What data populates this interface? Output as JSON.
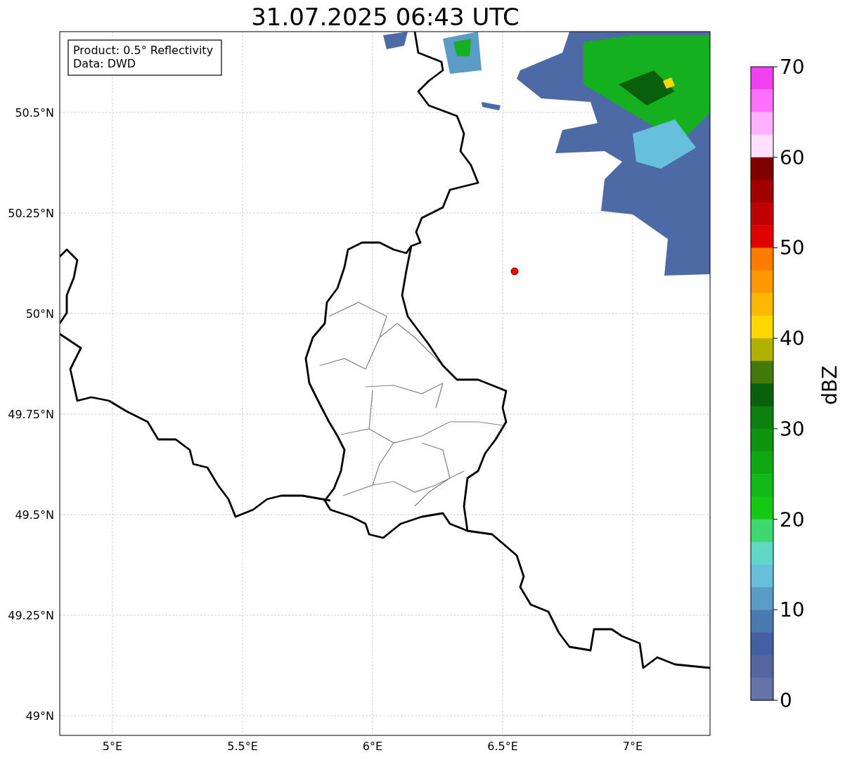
{
  "title": "31.07.2025 06:43 UTC",
  "info_box": {
    "lines": [
      "Product: 0.5° Reflectivity",
      "Data: DWD"
    ]
  },
  "y_axis": {
    "tick_labels": [
      "50.5°N",
      "50.25°N",
      "50°N",
      "49.75°N",
      "49.5°N",
      "49.25°N",
      "49°N"
    ]
  },
  "x_axis": {
    "tick_labels": [
      "5°E",
      "5.5°E",
      "6°E",
      "6.5°E",
      "7°E"
    ]
  },
  "colorbar": {
    "label": "dBZ",
    "tick_labels": [
      "70",
      "60",
      "50",
      "40",
      "30",
      "20",
      "10",
      "0"
    ],
    "bins": [
      {
        "color": "#f040f0"
      },
      {
        "color": "#ff70ff"
      },
      {
        "color": "#ffb0ff"
      },
      {
        "color": "#ffe0ff"
      },
      {
        "color": "#800000"
      },
      {
        "color": "#a00000"
      },
      {
        "color": "#c00000"
      },
      {
        "color": "#e00000"
      },
      {
        "color": "#ff7c00"
      },
      {
        "color": "#ff9800"
      },
      {
        "color": "#ffb800"
      },
      {
        "color": "#ffd700"
      },
      {
        "color": "#b0b000"
      },
      {
        "color": "#447a0a"
      },
      {
        "color": "#0a600a"
      },
      {
        "color": "#0c8010"
      },
      {
        "color": "#0e9410"
      },
      {
        "color": "#10a810"
      },
      {
        "color": "#10b818"
      },
      {
        "color": "#14c814"
      },
      {
        "color": "#3ed870"
      },
      {
        "color": "#60d8c8"
      },
      {
        "color": "#66c0dc"
      },
      {
        "color": "#5a9cc4"
      },
      {
        "color": "#4a7ab0"
      },
      {
        "color": "#4460a4"
      },
      {
        "color": "#5466a0"
      },
      {
        "color": "#6474a8"
      }
    ]
  }
}
